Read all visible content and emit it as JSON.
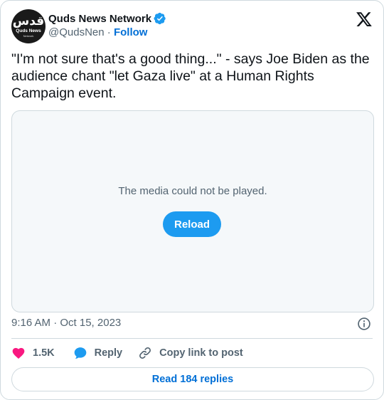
{
  "author": {
    "avatar": {
      "arabic_text": "قدس",
      "english_text": "Quds News",
      "sub_text": "Network"
    },
    "display_name": "Quds News Network",
    "handle": "@QudsNen",
    "separator": "·",
    "follow_label": "Follow",
    "verified": true
  },
  "tweet": {
    "text": "\"I'm not sure that's a good thing...\" - says Joe Biden as the audience chant \"let Gaza live\" at a Human Rights Campaign event."
  },
  "media": {
    "message": "The media could not be played.",
    "reload_label": "Reload"
  },
  "meta": {
    "timestamp": "9:16 AM · Oct 15, 2023"
  },
  "actions": {
    "like_count": "1.5K",
    "reply_label": "Reply",
    "copy_link_label": "Copy link to post"
  },
  "footer": {
    "read_replies_label": "Read 184 replies"
  },
  "colors": {
    "accent": "#1d9bf0",
    "link": "#006fd6",
    "like": "#f91880",
    "muted": "#536471",
    "border": "#cfd9de"
  }
}
